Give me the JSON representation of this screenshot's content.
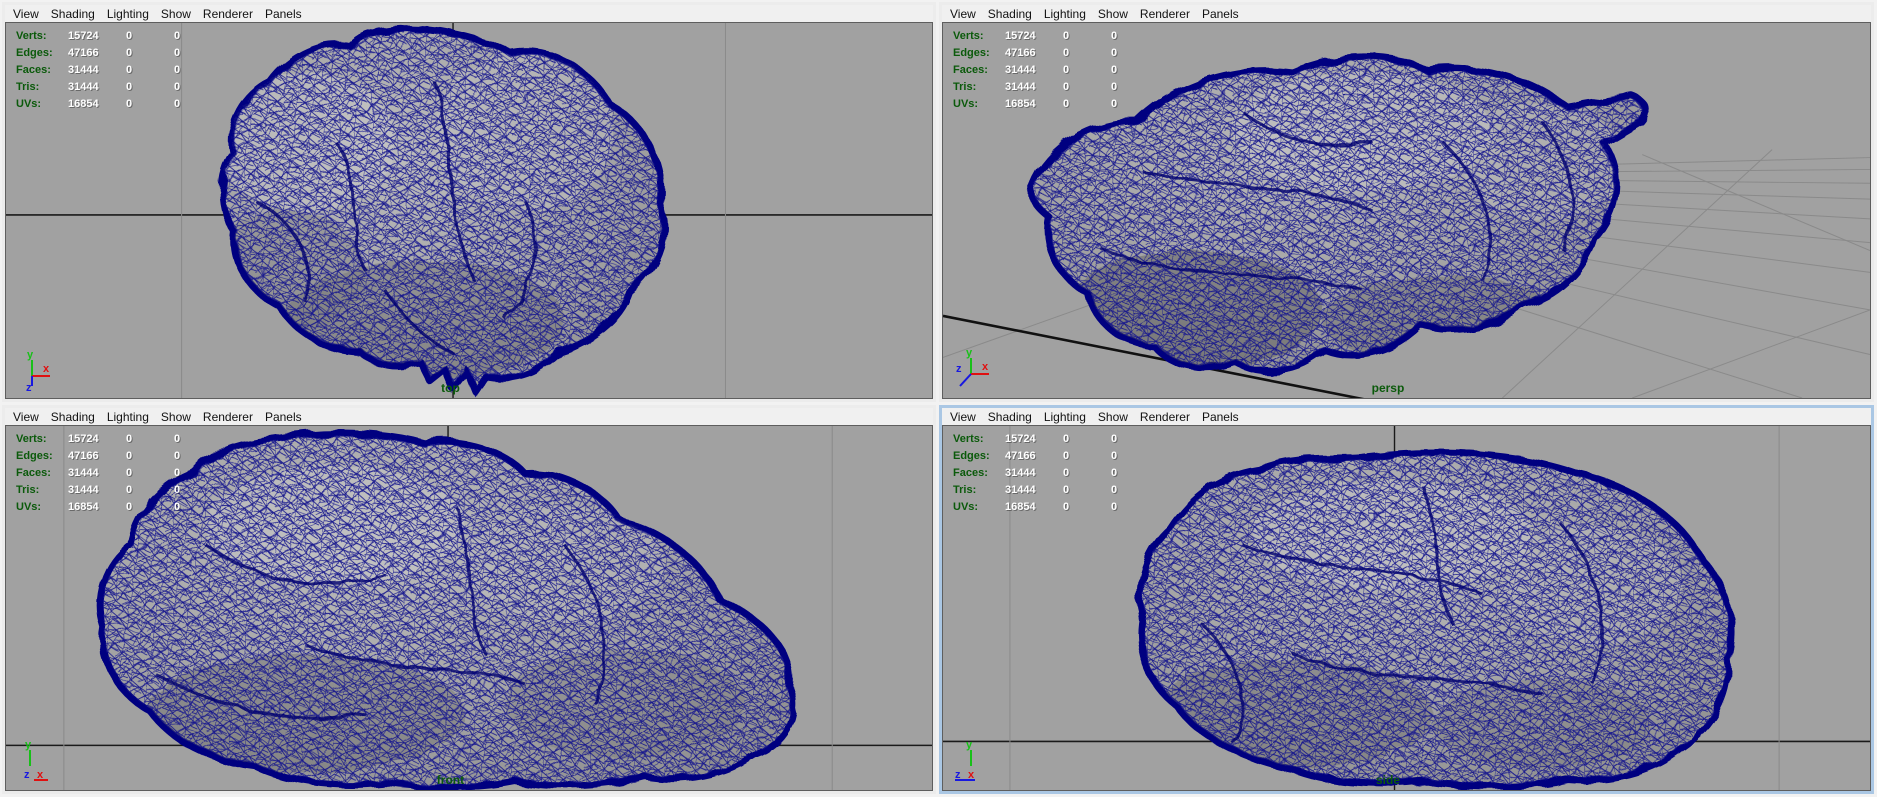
{
  "menu_items": [
    "View",
    "Shading",
    "Lighting",
    "Show",
    "Renderer",
    "Panels"
  ],
  "hud": {
    "rows": [
      {
        "label": "Verts:",
        "v1": "15724",
        "v2": "0",
        "v3": "0"
      },
      {
        "label": "Edges:",
        "v1": "47166",
        "v2": "0",
        "v3": "0"
      },
      {
        "label": "Faces:",
        "v1": "31444",
        "v2": "0",
        "v3": "0"
      },
      {
        "label": "Tris:",
        "v1": "31444",
        "v2": "0",
        "v3": "0"
      },
      {
        "label": "UVs:",
        "v1": "16854",
        "v2": "0",
        "v3": "0"
      }
    ]
  },
  "viewports": [
    {
      "label": "top"
    },
    {
      "label": "persp"
    },
    {
      "label": "front"
    },
    {
      "label": "side"
    }
  ],
  "axis": {
    "x": "x",
    "y": "y",
    "z": "z"
  },
  "colors": {
    "viewport_bg": "#a1a1a1",
    "menu_bg": "#f0f0f0",
    "wireframe": "#00008b",
    "hud_label_green": "#0b5a0b",
    "hud_value_white": "#ffffff",
    "view_label_green": "#0b5a0b",
    "active_border_blue": "#aac7e4",
    "grid_axis_black": "#1a1a1a",
    "grid_line_gray": "#8a8a8a",
    "axis_x_red": "#e01010",
    "axis_y_green": "#18c018",
    "axis_z_blue": "#1818e0"
  }
}
